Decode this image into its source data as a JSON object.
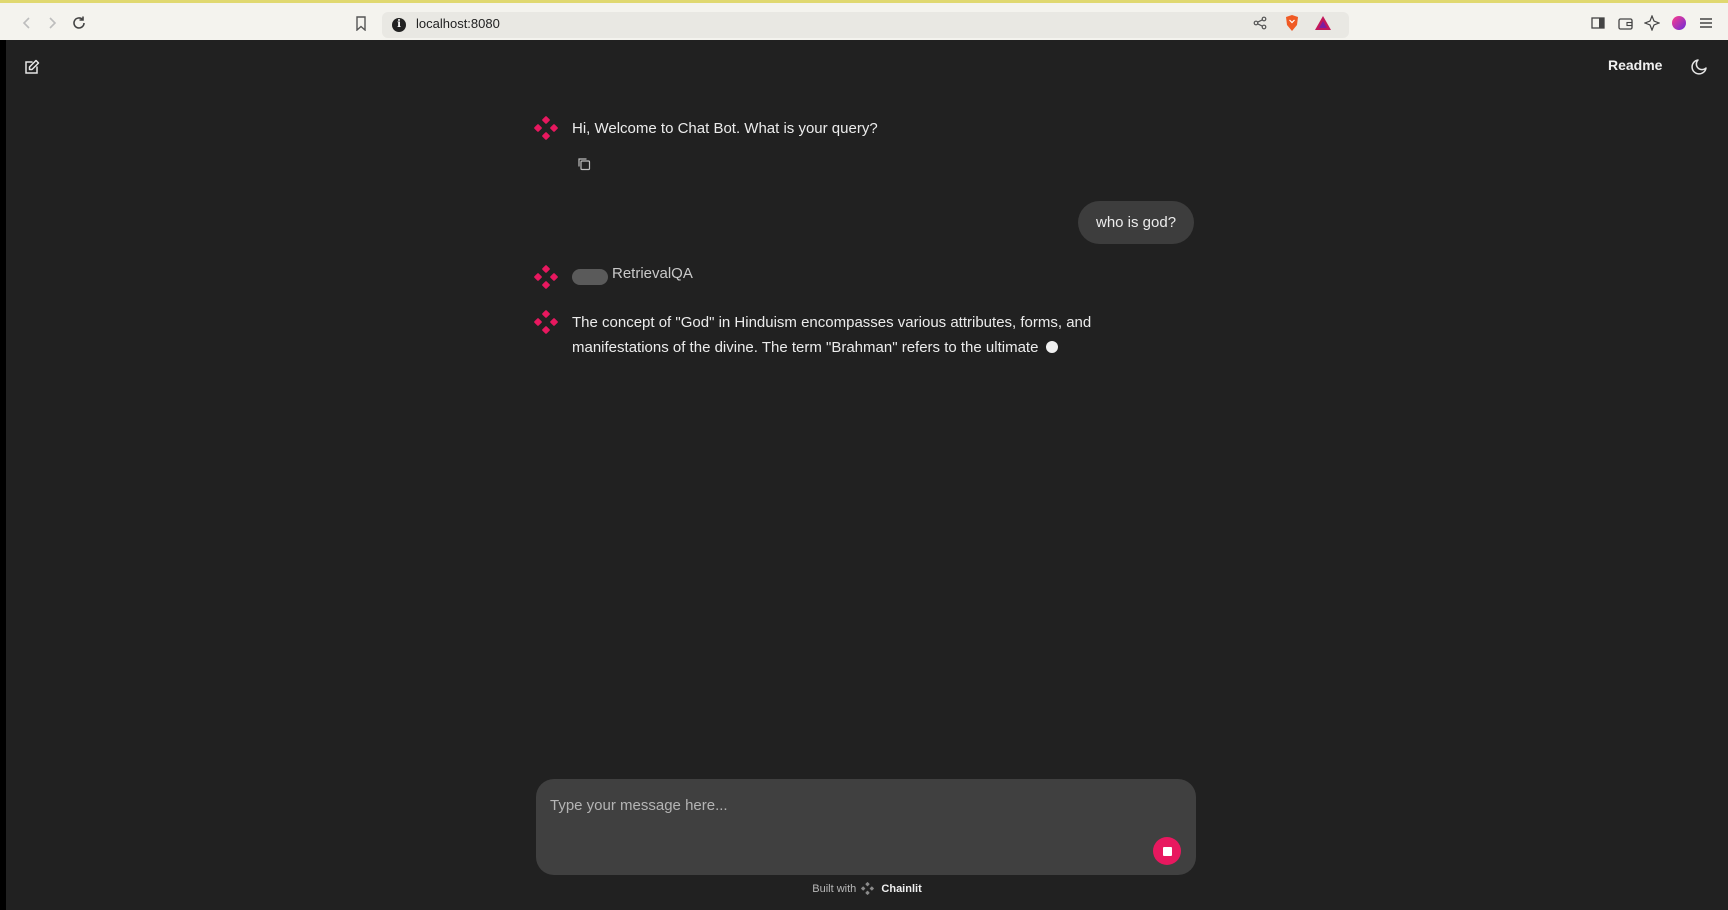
{
  "browser": {
    "url": "localhost:8080"
  },
  "header": {
    "readme_label": "Readme"
  },
  "messages": {
    "welcome": "Hi, Welcome to Chat Bot. What is your query?",
    "user_query": "who is god?",
    "step_name": "RetrievalQA",
    "answer_line1": "The concept of \"God\" in Hinduism encompasses various attributes, forms, and",
    "answer_line2": "manifestations of the divine. The term \"Brahman\" refers to the ultimate"
  },
  "composer": {
    "placeholder": "Type your message here..."
  },
  "footer": {
    "built_with": "Built with",
    "brand": "Chainlit"
  },
  "colors": {
    "accent": "#e8185f",
    "background": "#212121",
    "composer": "#404040",
    "user_bubble": "#3d3d3d"
  },
  "icons": [
    "back-icon",
    "forward-icon",
    "reload-icon",
    "bookmark-icon",
    "info-icon",
    "share-icon",
    "brave-shield-icon",
    "brave-rewards-icon",
    "sidebar-icon",
    "wallet-icon",
    "leo-ai-icon",
    "vpn-icon",
    "menu-icon",
    "new-chat-icon",
    "moon-icon",
    "chainlit-logo-icon",
    "copy-icon",
    "stop-icon"
  ]
}
